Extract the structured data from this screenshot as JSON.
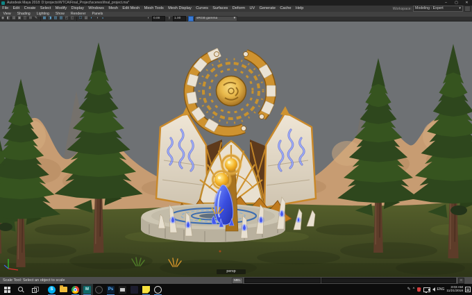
{
  "window": {
    "app": "Autodesk Maya",
    "title": "Autodesk Maya 2018: D:\\projects\\WTCA\\Final_Project\\scenes\\final_project.ma*",
    "controls": {
      "minimize": "–",
      "maximize": "▢",
      "close": "✕"
    }
  },
  "menubar": {
    "items": [
      "File",
      "Edit",
      "Create",
      "Select",
      "Modify",
      "Display",
      "Windows",
      "Mesh",
      "Edit Mesh",
      "Mesh Tools",
      "Mesh Display",
      "Curves",
      "Surfaces",
      "Deform",
      "UV",
      "Generate",
      "Cache",
      "Help"
    ],
    "workspace_label": "Workspace:",
    "workspace_value": "Modeling - Expert",
    "workspace_caret": "▾"
  },
  "panel_menubar": {
    "items": [
      "View",
      "Shading",
      "Lighting",
      "Show",
      "Renderer",
      "Panels"
    ]
  },
  "panel_toolbar": {
    "icons": [
      {
        "name": "select-camera-icon",
        "glyph": "◉",
        "active": false
      },
      {
        "name": "lock-camera-icon",
        "glyph": "◧",
        "active": false
      },
      {
        "name": "camera-attributes-icon",
        "glyph": "▤",
        "active": false
      },
      {
        "name": "bookmarks-icon",
        "glyph": "▣",
        "active": false
      },
      {
        "name": "image-plane-icon",
        "glyph": "◫",
        "active": false
      },
      {
        "name": "pan-zoom-icon",
        "glyph": "⊞",
        "active": false
      },
      {
        "name": "grease-pencil-icon",
        "glyph": "✎",
        "active": false
      },
      {
        "name": "grid-icon",
        "glyph": "▦",
        "active": true
      },
      {
        "name": "film-gate-icon",
        "glyph": "◨",
        "active": true
      },
      {
        "name": "resolution-gate-icon",
        "glyph": "▥",
        "active": true
      },
      {
        "name": "gate-mask-icon",
        "glyph": "▧",
        "active": true
      },
      {
        "name": "safe-action-icon",
        "glyph": "◰",
        "active": false
      },
      {
        "name": "safe-title-icon",
        "glyph": "◱",
        "active": false
      },
      {
        "name": "hud-icon",
        "glyph": "☐",
        "active": true
      },
      {
        "name": "object-details-icon",
        "glyph": "▤",
        "active": false
      },
      {
        "name": "default-lighting-icon",
        "glyph": "◐",
        "active": true
      },
      {
        "name": "shadows-icon",
        "glyph": "◑",
        "active": false
      },
      {
        "name": "ssao-icon",
        "glyph": "◒",
        "active": true
      }
    ],
    "exposure_icon": "◐",
    "exposure_value": "0.00",
    "gamma_icon": "γ",
    "gamma_value": "1.00",
    "colorspace": "sRGB gamma",
    "colorspace_caret": "▾"
  },
  "viewport": {
    "camera_label": "persp",
    "scene_palette": {
      "sky": "#6e7174",
      "cliffs": "#c79c72",
      "grass_light": "#57612c",
      "grass_dark": "#343c1c",
      "tree_foliage": "#2e471d",
      "tree_trunk": "#5d3c29",
      "marble": "#e9e0d0",
      "gold": "#cf9330",
      "gold_dark": "#8a5a12",
      "crystal_blue": "#4458ee",
      "platform_ring_blue": "#3e6eb0",
      "selection_dot": "#b8e438"
    }
  },
  "helpline": {
    "message": "Scale Tool: Select an object to scale",
    "language_button": "MEL"
  },
  "taskbar": {
    "apps": [
      {
        "name": "skype",
        "glyph": "S",
        "running": true
      },
      {
        "name": "file-explorer",
        "glyph": "",
        "running": false
      },
      {
        "name": "chrome",
        "glyph": "",
        "running": true
      },
      {
        "name": "maya",
        "glyph": "M",
        "running": true,
        "active": true
      },
      {
        "name": "round-app",
        "glyph": "",
        "running": false
      },
      {
        "name": "photoshop",
        "glyph": "Ps",
        "running": true
      },
      {
        "name": "photos-app",
        "glyph": "",
        "running": false
      },
      {
        "name": "adobe-app",
        "glyph": "",
        "running": false
      },
      {
        "name": "sticky-notes",
        "glyph": "",
        "running": true
      },
      {
        "name": "circle-app",
        "glyph": "",
        "running": true
      }
    ],
    "tray": {
      "language": "ENG",
      "time": "3:03 AM",
      "date": "11/21/2018"
    }
  }
}
